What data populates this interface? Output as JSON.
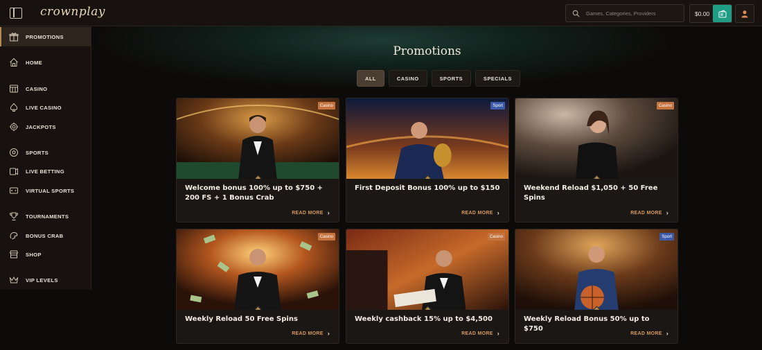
{
  "header": {
    "logo": "crownplay",
    "search_placeholder": "Games, Categories, Providers",
    "balance": "$0.00"
  },
  "sidebar": {
    "items": [
      {
        "label": "PROMOTIONS",
        "icon": "gift-icon",
        "active": true
      },
      {
        "label": "HOME",
        "icon": "home-icon"
      },
      {
        "label": "CASINO",
        "icon": "slot-icon"
      },
      {
        "label": "LIVE CASINO",
        "icon": "spade-icon"
      },
      {
        "label": "JACKPOTS",
        "icon": "gear-coin-icon"
      },
      {
        "label": "SPORTS",
        "icon": "soccer-ball-icon"
      },
      {
        "label": "LIVE BETTING",
        "icon": "live-icon"
      },
      {
        "label": "VIRTUAL SPORTS",
        "icon": "gamepad-icon"
      },
      {
        "label": "TOURNAMENTS",
        "icon": "trophy-icon"
      },
      {
        "label": "BONUS CRAB",
        "icon": "crab-icon"
      },
      {
        "label": "SHOP",
        "icon": "shop-icon"
      },
      {
        "label": "VIP LEVELS",
        "icon": "crown-icon"
      }
    ]
  },
  "main": {
    "title": "Promotions",
    "filters": [
      "ALL",
      "CASINO",
      "SPORTS",
      "SPECIALS"
    ],
    "active_filter": "ALL",
    "read_more": "READ MORE",
    "cards": [
      {
        "badge": "Casino",
        "title": "Welcome bonus 100% up to $750 + 200 FS + 1 Bonus Crab"
      },
      {
        "badge": "Sport",
        "title": "First Deposit Bonus 100% up to $150"
      },
      {
        "badge": "Casino",
        "title": "Weekend Reload $1,050 + 50 Free Spins"
      },
      {
        "badge": "Casino",
        "title": "Weekly Reload 50 Free Spins"
      },
      {
        "badge": "Casino",
        "title": "Weekly cashback 15% up to $4,500"
      },
      {
        "badge": "Sport",
        "title": "Weekly Reload Bonus 50% up to $750"
      }
    ]
  },
  "colors": {
    "accent": "#b08a4f",
    "wallet": "#1f9c84",
    "casino_badge": "#c4733e",
    "sport_badge": "#3d5aa8",
    "read_more": "#d79a5a"
  }
}
